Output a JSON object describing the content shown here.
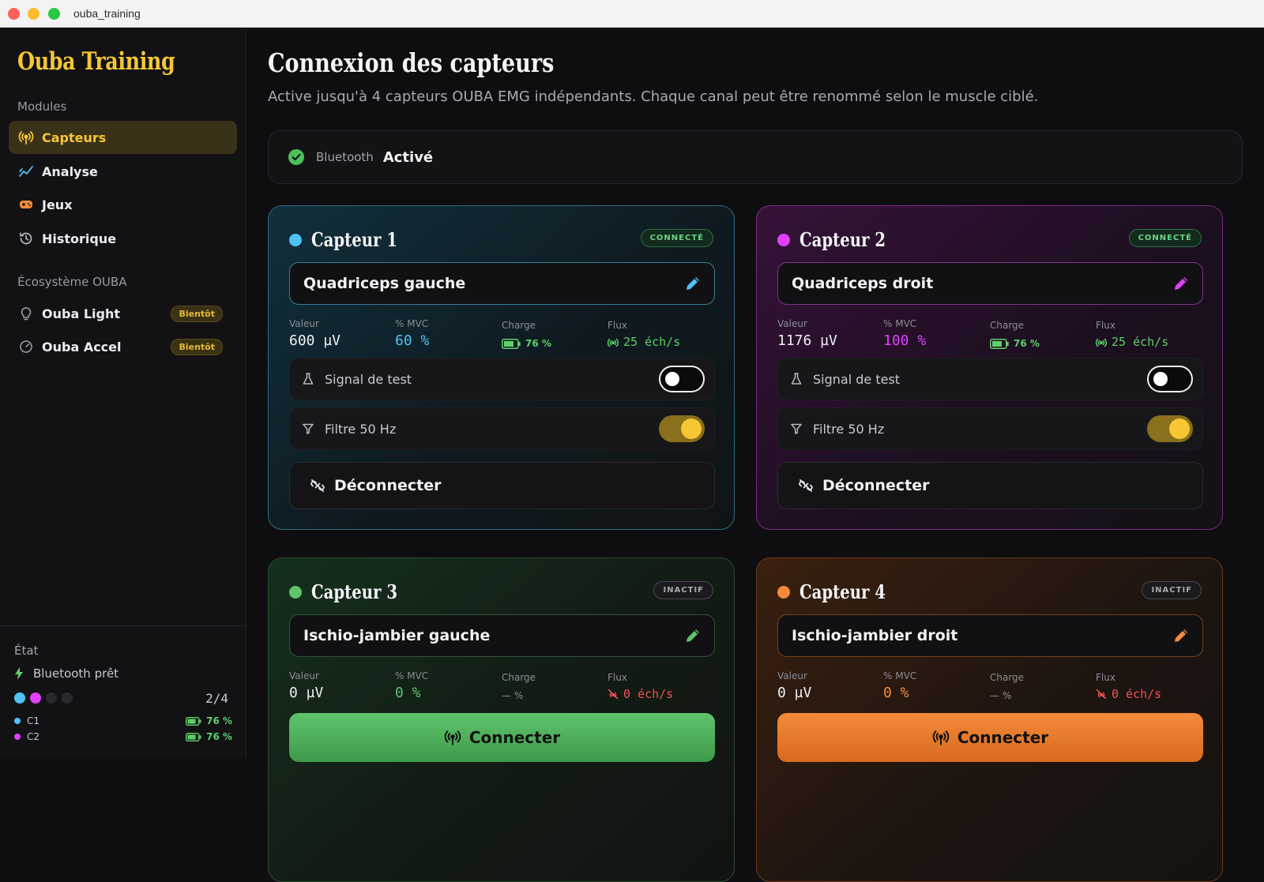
{
  "window": {
    "title": "ouba_training"
  },
  "sidebar": {
    "brand": "Ouba Training",
    "modules_label": "Modules",
    "items": [
      {
        "label": "Capteurs",
        "icon": "antenna-icon",
        "active": true
      },
      {
        "label": "Analyse",
        "icon": "trend-chart-icon",
        "active": false
      },
      {
        "label": "Jeux",
        "icon": "gamepad-icon",
        "active": false
      },
      {
        "label": "Historique",
        "icon": "history-icon",
        "active": false
      }
    ],
    "ecosystem_label": "Écosystème OUBA",
    "ecosystem": [
      {
        "label": "Ouba Light",
        "icon": "lightbulb-icon",
        "badge": "Bientôt"
      },
      {
        "label": "Ouba Accel",
        "icon": "gauge-icon",
        "badge": "Bientôt"
      }
    ],
    "footer": {
      "state_label": "État",
      "bluetooth_status": "Bluetooth prêt",
      "count": "2/4",
      "channels": [
        {
          "label": "C1",
          "battery": "76 %"
        },
        {
          "label": "C2",
          "battery": "76 %"
        }
      ]
    }
  },
  "main": {
    "title": "Connexion des capteurs",
    "subtitle": "Active jusqu'à 4 capteurs OUBA EMG indépendants. Chaque canal peut être renommé selon le muscle ciblé.",
    "bluetooth": {
      "label": "Bluetooth",
      "value": "Activé"
    },
    "metric_labels": {
      "value": "Valeur",
      "mvc": "% MVC",
      "charge": "Charge",
      "flux": "Flux"
    },
    "toggles": {
      "test_signal": "Signal de test",
      "filter": "Filtre 50 Hz"
    },
    "disconnect_label": "Déconnecter",
    "connect_label": "Connecter",
    "sensors": [
      {
        "title": "Capteur 1",
        "status": "CONNECTÉ",
        "name": "Quadriceps gauche",
        "value": "600 µV",
        "mvc": "60 %",
        "charge": "76 %",
        "flux": "25 éch/s",
        "test_signal": false,
        "filter": true
      },
      {
        "title": "Capteur 2",
        "status": "CONNECTÉ",
        "name": "Quadriceps droit",
        "value": "1176 µV",
        "mvc": "100 %",
        "charge": "76 %",
        "flux": "25 éch/s",
        "test_signal": false,
        "filter": true
      },
      {
        "title": "Capteur 3",
        "status": "INACTIF",
        "name": "Ischio-jambier gauche",
        "value": "0 µV",
        "mvc": "0 %",
        "charge": "— %",
        "flux": "0 éch/s"
      },
      {
        "title": "Capteur 4",
        "status": "INACTIF",
        "name": "Ischio-jambier droit",
        "value": "0 µV",
        "mvc": "0 %",
        "charge": "— %",
        "flux": "0 éch/s"
      }
    ]
  },
  "colors": {
    "accent": "#f6c635",
    "sensor1": "#4fc3f7",
    "sensor2": "#e040fb",
    "sensor3": "#5fc46c",
    "sensor4": "#f48a3a",
    "connected": "#6bd48a",
    "inactive_flux": "#f05454"
  }
}
